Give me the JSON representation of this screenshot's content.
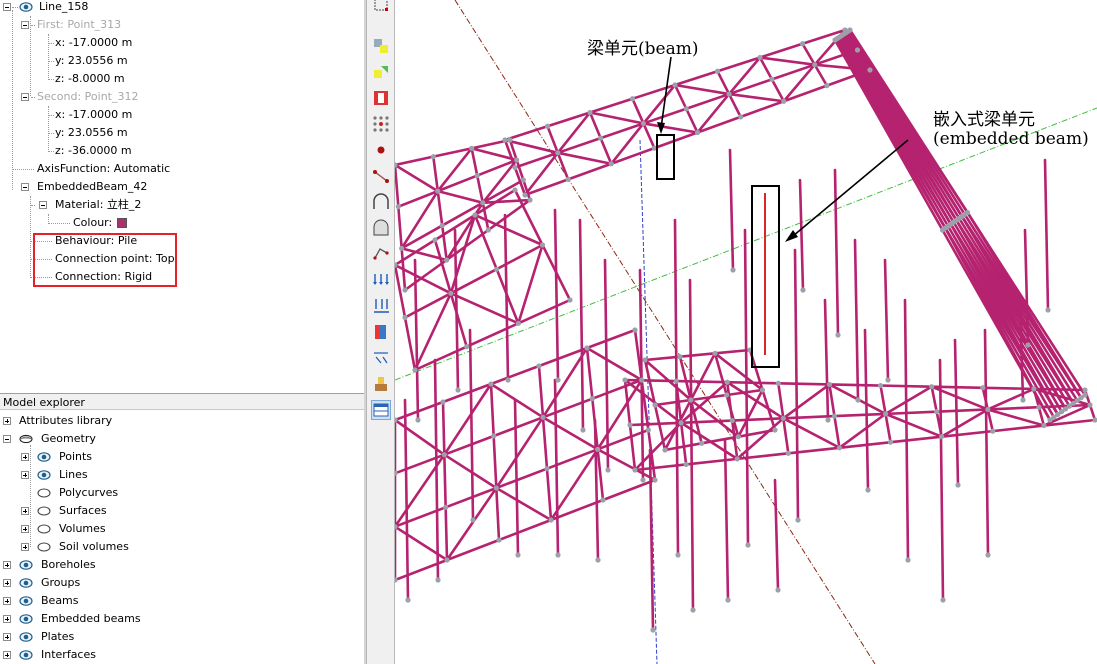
{
  "properties": {
    "line_name": "Line_158",
    "first_point": "First: Point_313",
    "first_x": "x: -17.0000 m",
    "first_y": "y: 23.0556 m",
    "first_z": "z: -8.0000 m",
    "second_point": "Second: Point_312",
    "second_x": "x: -17.0000 m",
    "second_y": "y: 23.0556 m",
    "second_z": "z: -36.0000 m",
    "axis_function": "AxisFunction: Automatic",
    "embedded_beam": "EmbeddedBeam_42",
    "material": "Material: 立柱_2",
    "colour": "Colour:",
    "colour_value": "#a8336b",
    "behaviour": "Behaviour: Pile",
    "connection_point": "Connection point: Top",
    "connection": "Connection: Rigid"
  },
  "explorer": {
    "title": "Model explorer",
    "items": [
      {
        "label": "Attributes library"
      },
      {
        "label": "Geometry"
      },
      {
        "label": "Points"
      },
      {
        "label": "Lines"
      },
      {
        "label": "Polycurves"
      },
      {
        "label": "Surfaces"
      },
      {
        "label": "Volumes"
      },
      {
        "label": "Soil volumes"
      },
      {
        "label": "Boreholes"
      },
      {
        "label": "Groups"
      },
      {
        "label": "Beams"
      },
      {
        "label": "Embedded beams"
      },
      {
        "label": "Plates"
      },
      {
        "label": "Interfaces"
      }
    ]
  },
  "toolbar": {
    "icons": [
      "select-rect-icon",
      "move-icon",
      "rotate-icon",
      "delete-icon",
      "node-grid-icon",
      "point-icon",
      "line-icon",
      "tunnel-icon",
      "tunnel-designer-icon",
      "polycurve-icon",
      "distributed-load-icon",
      "line-load-icon",
      "surface-icon",
      "prescribed-displacement-icon",
      "soil-icon",
      "table-icon"
    ]
  },
  "viewport": {
    "annotation_beam": "梁单元(beam)",
    "annotation_embedded_line1": "嵌入式梁单元",
    "annotation_embedded_line2": "(embedded beam)",
    "structure_color": "#b5226f",
    "node_color": "#9ca0a8"
  }
}
